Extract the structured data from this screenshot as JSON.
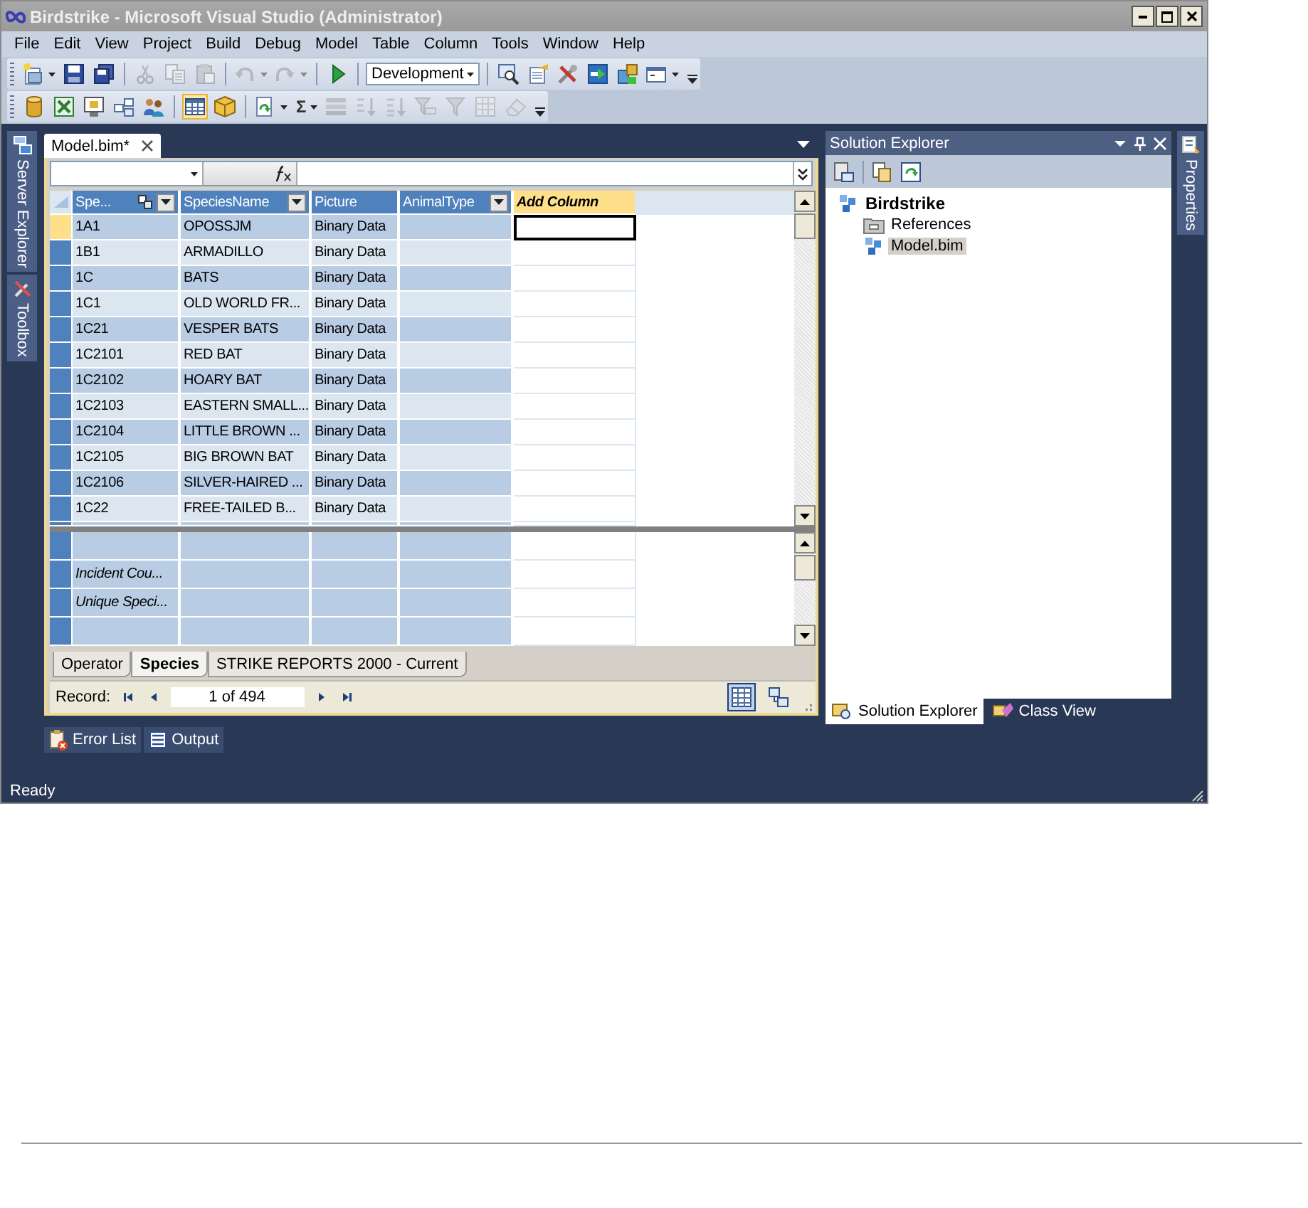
{
  "window": {
    "title": "Birdstrike - Microsoft Visual Studio (Administrator)"
  },
  "menu": [
    "File",
    "Edit",
    "View",
    "Project",
    "Build",
    "Debug",
    "Model",
    "Table",
    "Column",
    "Tools",
    "Window",
    "Help"
  ],
  "toolbars": [
    [
      {
        "kind": "new",
        "disabled": false,
        "checked": false,
        "dropdown": true
      },
      {
        "kind": "save",
        "disabled": false,
        "checked": false,
        "dropdown": false
      },
      {
        "kind": "saveall",
        "disabled": false,
        "checked": false,
        "dropdown": false
      },
      {
        "kind": "separator"
      },
      {
        "kind": "cut",
        "disabled": true,
        "checked": false,
        "dropdown": false
      },
      {
        "kind": "copy",
        "disabled": true,
        "checked": false,
        "dropdown": false
      },
      {
        "kind": "paste",
        "disabled": true,
        "checked": false,
        "dropdown": false
      },
      {
        "kind": "separator"
      },
      {
        "kind": "undo",
        "disabled": true,
        "checked": false,
        "dropdown": true
      },
      {
        "kind": "redo",
        "disabled": true,
        "checked": false,
        "dropdown": true
      },
      {
        "kind": "separator"
      },
      {
        "kind": "start",
        "disabled": false,
        "checked": false,
        "dropdown": false
      },
      {
        "kind": "separator"
      },
      {
        "kind": "combo",
        "value": "Development"
      },
      {
        "kind": "separator"
      },
      {
        "kind": "find",
        "disabled": false,
        "checked": false,
        "dropdown": false
      },
      {
        "kind": "props",
        "disabled": false,
        "checked": false,
        "dropdown": false
      },
      {
        "kind": "tools",
        "disabled": false,
        "checked": false,
        "dropdown": false
      },
      {
        "kind": "import",
        "disabled": false,
        "checked": false,
        "dropdown": false
      },
      {
        "kind": "layout",
        "disabled": false,
        "checked": false,
        "dropdown": false
      },
      {
        "kind": "window",
        "disabled": false,
        "checked": false,
        "dropdown": true
      },
      {
        "kind": "overflow"
      }
    ],
    [
      {
        "kind": "database",
        "disabled": false,
        "checked": false,
        "dropdown": false
      },
      {
        "kind": "excel",
        "disabled": false,
        "checked": false,
        "dropdown": false
      },
      {
        "kind": "report",
        "disabled": false,
        "checked": false,
        "dropdown": false
      },
      {
        "kind": "relations",
        "disabled": false,
        "checked": false,
        "dropdown": false
      },
      {
        "kind": "roles",
        "disabled": false,
        "checked": false,
        "dropdown": false
      },
      {
        "kind": "separator"
      },
      {
        "kind": "grid",
        "disabled": false,
        "checked": true,
        "dropdown": false
      },
      {
        "kind": "cube",
        "disabled": false,
        "checked": false,
        "dropdown": false
      },
      {
        "kind": "separator"
      },
      {
        "kind": "calc",
        "disabled": false,
        "checked": false,
        "dropdown": true
      },
      {
        "kind": "sigma",
        "label": "Σ",
        "disabled": false,
        "checked": false,
        "dropdown": true
      },
      {
        "kind": "stack",
        "disabled": true,
        "checked": false,
        "dropdown": false
      },
      {
        "kind": "sortasc",
        "disabled": true,
        "checked": false,
        "dropdown": false
      },
      {
        "kind": "sortdesc",
        "disabled": true,
        "checked": false,
        "dropdown": false
      },
      {
        "kind": "clearfilter",
        "disabled": true,
        "checked": false,
        "dropdown": false
      },
      {
        "kind": "filter",
        "disabled": true,
        "checked": false,
        "dropdown": false
      },
      {
        "kind": "tableprops",
        "disabled": true,
        "checked": false,
        "dropdown": false
      },
      {
        "kind": "eraser",
        "disabled": true,
        "checked": false,
        "dropdown": false
      },
      {
        "kind": "overflow"
      }
    ]
  ],
  "side_tabs_left": [
    {
      "label": "Server Explorer",
      "kind": "server"
    },
    {
      "label": "Toolbox",
      "kind": "toolbox"
    }
  ],
  "document": {
    "tab": {
      "label": "Model.bim*",
      "selected": true
    },
    "grid": {
      "columns": [
        {
          "label": "Spe...",
          "filter": true,
          "pinned": true
        },
        {
          "label": "SpeciesName",
          "filter": true,
          "pinned": false
        },
        {
          "label": "Picture",
          "filter": false,
          "pinned": false
        },
        {
          "label": "AnimalType",
          "filter": true,
          "pinned": false
        }
      ],
      "new_column": "Add Column",
      "rows": [
        {
          "cells": [
            "1A1",
            "OPOSSJM",
            "Binary Data"
          ],
          "current": true
        },
        {
          "cells": [
            "1B1",
            "ARMADILLO",
            "Binary Data"
          ],
          "current": false
        },
        {
          "cells": [
            "1C",
            "BATS",
            "Binary Data"
          ],
          "current": false
        },
        {
          "cells": [
            "1C1",
            "OLD WORLD FR...",
            "Binary Data"
          ],
          "current": false
        },
        {
          "cells": [
            "1C21",
            "VESPER BATS",
            "Binary Data"
          ],
          "current": false
        },
        {
          "cells": [
            "1C2101",
            "RED BAT",
            "Binary Data"
          ],
          "current": false
        },
        {
          "cells": [
            "1C2102",
            "HOARY BAT",
            "Binary Data"
          ],
          "current": false
        },
        {
          "cells": [
            "1C2103",
            "EASTERN SMALL...",
            "Binary Data"
          ],
          "current": false
        },
        {
          "cells": [
            "1C2104",
            "LITTLE BROWN ...",
            "Binary Data"
          ],
          "current": false
        },
        {
          "cells": [
            "1C2105",
            "BIG BROWN BAT",
            "Binary Data"
          ],
          "current": false
        },
        {
          "cells": [
            "1C2106",
            "SILVER-HAIRED ...",
            "Binary Data"
          ],
          "current": false
        },
        {
          "cells": [
            "1C22",
            "FREE-TAILED B...",
            "Binary Data"
          ],
          "current": false
        }
      ]
    },
    "measures": [
      "Incident Cou...",
      "Unique Speci..."
    ],
    "sheets": [
      {
        "label": "Operator",
        "selected": false
      },
      {
        "label": "Species",
        "selected": true
      },
      {
        "label": "STRIKE REPORTS  2000 - Current",
        "selected": false
      }
    ],
    "record": {
      "label": "Record:",
      "value": "1 of 494"
    },
    "views": [
      {
        "kind": "grid",
        "selected": true
      },
      {
        "kind": "diagram",
        "selected": false
      }
    ]
  },
  "tool_tabs": [
    {
      "label": "Error List",
      "kind": "errors"
    },
    {
      "label": "Output",
      "kind": "output"
    }
  ],
  "solution_explorer": {
    "title": "Solution Explorer",
    "tree": [
      {
        "label": "Birdstrike",
        "selected": false,
        "children": [
          {
            "label": "References",
            "kind": "folder",
            "selected": false
          },
          {
            "label": "Model.bim",
            "kind": "model",
            "selected": true
          }
        ]
      }
    ],
    "tabs": [
      {
        "label": "Solution Explorer",
        "kind": "solution",
        "selected": true
      },
      {
        "label": "Class View",
        "kind": "classview",
        "selected": false
      }
    ]
  },
  "side_tabs_right": [
    {
      "label": "Properties"
    }
  ],
  "status_bar": "Ready"
}
